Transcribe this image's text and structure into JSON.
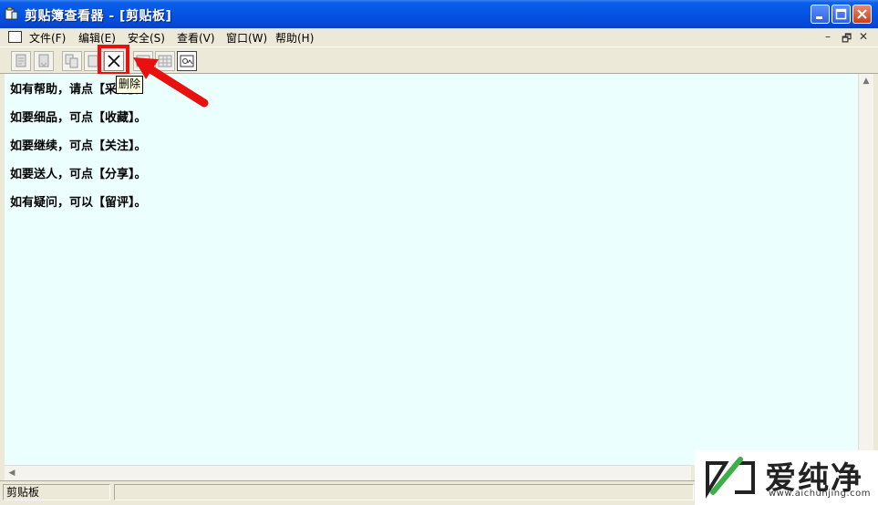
{
  "window": {
    "title": "剪贴簿查看器 - [剪贴板]"
  },
  "menu": {
    "items": [
      "文件(F)",
      "编辑(E)",
      "安全(S)",
      "查看(V)",
      "窗口(W)",
      "帮助(H)"
    ],
    "mdi_controls": [
      "–",
      "🗗",
      "✕"
    ]
  },
  "toolbar": {
    "buttons": [
      "open-icon",
      "save-icon",
      "copy-icon",
      "paste-icon",
      "delete-icon",
      "list-icon",
      "grid-icon",
      "picture-icon"
    ],
    "tooltip": "删除"
  },
  "content": {
    "lines": [
      "如有帮助，请点【采用】。",
      "如要细品，可点【收藏】。",
      "如要继续，可点【关注】。",
      "如要送人，可点【分享】。",
      "如有疑问，可以【留评】。"
    ]
  },
  "status": {
    "left": "剪贴板"
  },
  "watermark": {
    "brand": "爱纯净",
    "url": "www.aichunjing.com"
  },
  "colors": {
    "titlebar": "#0554e3",
    "content_bg": "#eafffe",
    "highlight": "#e8110f"
  }
}
